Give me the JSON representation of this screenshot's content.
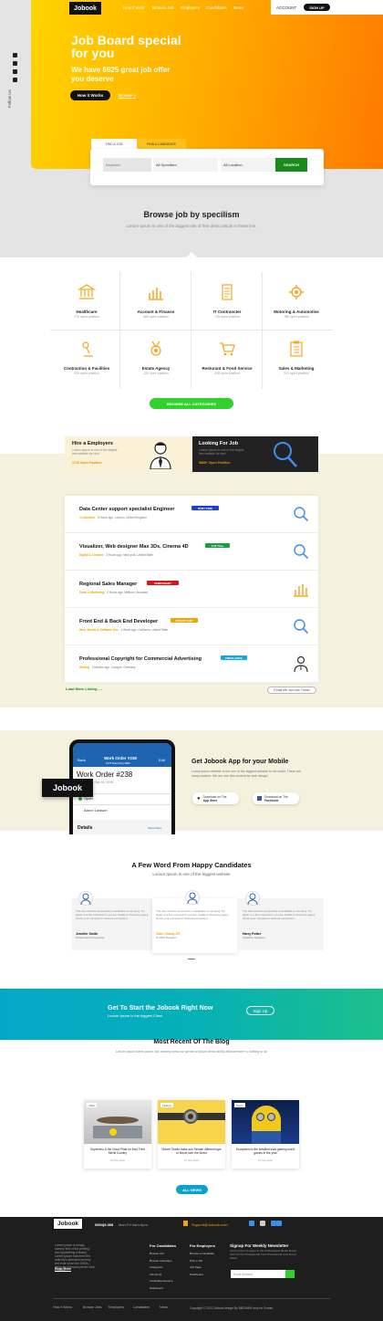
{
  "header": {
    "logo": "Jobook",
    "nav": [
      "How it work",
      "Browse Job",
      "Employers",
      "Candidates",
      "News"
    ],
    "account": "ACCOUNT",
    "signup": "SIGN UP",
    "follow": "Follow Us"
  },
  "hero": {
    "title": "Job Board special for you",
    "subtitle": "We have 6925 great job offer you deserve",
    "how_button": "How it Works",
    "browse_link": "Browse >"
  },
  "search": {
    "tab_find": "FIND A JOB",
    "tab_candidates": "FIND A CANDIDATE",
    "keyword_placeholder": "Keyword",
    "specialism": "All Specilism",
    "location": "All Location",
    "button": "SEARCH"
  },
  "browse": {
    "title": "Browse job by specilism",
    "subtitle": "Lorium Ipsum is one of the biggest site of free demo article in these line.",
    "categories": [
      {
        "name": "Healthcare",
        "count": "776 open position",
        "icon": "bank-icon"
      },
      {
        "name": "Account & Finance",
        "count": "689 open position",
        "icon": "bar-chart-icon"
      },
      {
        "name": "IT Contrancter",
        "count": "726 open position",
        "icon": "document-list-icon"
      },
      {
        "name": "Motoring & Automotive",
        "count": "786 open position",
        "icon": "gear-icon"
      },
      {
        "name": "Contraction & Facilities",
        "count": "325 open position",
        "icon": "lamp-icon"
      },
      {
        "name": "Estate Agency",
        "count": "120 open position",
        "icon": "medal-icon"
      },
      {
        "name": "Resturant & Food Service",
        "count": "508 open position",
        "icon": "cart-icon"
      },
      {
        "name": "Sales & Marketing",
        "count": "212 open position",
        "icon": "clipboard-icon"
      }
    ],
    "all_button": "BROWSE ALL CATEGORIES"
  },
  "promo": {
    "hire": {
      "title": "Hire a Employers",
      "desc": "Lorium ipsum is one of the largest free website for html",
      "positions": "1725 Open Position"
    },
    "look": {
      "title": "Looking For Job",
      "desc": "Lorium ipsum is one of the largest free website for html",
      "positions": "5685+ Open Position"
    }
  },
  "jobs": {
    "items": [
      {
        "title": "Data Center support specialist Engineer",
        "tag": "PART TIME",
        "tag_color": "#1f3fd6",
        "category": "4 Liberated",
        "time": "4 Hours ago",
        "location": "London, United Kingdom",
        "icon": "magnifier-icon"
      },
      {
        "title": "Visualizer, Web designer Max 3Ds, Cinema 4D",
        "tag": "Full Time",
        "tag_color": "#14a23c",
        "category": "Digital & Creative",
        "time": "3 Hours ago",
        "location": "New york, United State",
        "icon": "magnifier-icon"
      },
      {
        "title": "Regional Sales Manager",
        "tag": "TEMPORARY",
        "tag_color": "#d91616",
        "category": "Sales & Marketing",
        "time": "4 Hours ago",
        "location": "Melburn, Australia",
        "icon": "bar-chart-icon"
      },
      {
        "title": "Front End & Back End Developer",
        "tag": "INTERN SHIP",
        "tag_color": "#f0a500",
        "category": "Web, Mobile & Software Dev",
        "time": "1 Week ago",
        "location": "California, United State",
        "icon": "magnifier-icon"
      },
      {
        "title": "Professional Copyright for Commercial Advertising",
        "tag": "FREELANCE",
        "tag_color": "#17a8d8",
        "category": "Writing",
        "time": "2 Months ago",
        "location": "Cologne, Germany",
        "icon": "person-icon"
      }
    ],
    "load_more": "Load More Listing ....",
    "email_me": "Email Me Job Like These"
  },
  "app": {
    "phone_title": "Work Order #238",
    "phone_sub": "1275 Branching 4850",
    "phone_back": "Back",
    "phone_edit": "Edit",
    "phone_heading": "Work Order #238",
    "phone_date": "Due Sep 16, 2016",
    "phone_status": "Open",
    "phone_person": "Aaron Lawson",
    "phone_details": "Details",
    "phone_show_more": "Show More",
    "logo": "Jobook",
    "title": "Get Jobook App for your Mobile",
    "desc": "Lorius Ipsum website is the one of the biggest website to the world. There are many content. We are use this content for web design.",
    "appstore_small": "Download on The",
    "appstore": "App Store",
    "facebook_small": "Download on The",
    "facebook": "Facebook"
  },
  "testimonials": {
    "title": "A Few Word From Happy Candidates",
    "subtitle": "Lorium Ipsum is one of the biggest website",
    "items": [
      {
        "text": "The site could be temporarily unavailable or too busy. Try again in a few moments if you are unable to load any pages, check your computer's network connection.",
        "name": "Jennifer Smith",
        "role": "Professional Copywriter"
      },
      {
        "text": "The site could be temporarily unavailable or too busy. Try again in a few moments if you are unable to load any pages, check your computer's network connection.",
        "name": "John Chong JR",
        "role": "UI Web Designer"
      },
      {
        "text": "The site could be temporarily unavailable or too busy. Try again in a few moments if you are unable to load any pages, check your computer's network connection.",
        "name": "Harry Potter",
        "role": "Graphics Designer"
      }
    ]
  },
  "cta": {
    "title": "Get To Start the Jobook Right Now",
    "subtitle": "Lorium Ipsum is the biggest Client",
    "button": "Sign Up"
  },
  "blog": {
    "title": "Most Recent Of The Blog",
    "subtitle": "Lorium Ipsum lorem ipsum has dummy meta our gentre ai ipsum demo ability alliance there is nothing to do",
    "items": [
      {
        "tag": "Video",
        "title": "Superhero & the Good Pride for they Third Minifil Country",
        "date": "25 Nov 2016"
      },
      {
        "tag": "Fashion",
        "title": "Marvel Studio make and Sinister different type of Movie over the World",
        "date": "27 Nov 2016"
      },
      {
        "tag": "Game",
        "title": "Ecosystem is the smallest work gaming world games in the year",
        "date": "23 Nov 2016"
      }
    ],
    "all_button": "ALL NEWS"
  },
  "footer": {
    "logo": "Jobook",
    "phone": "0854(5.368",
    "hours": "Mon-Fri 9am-9pm",
    "email": "Support@Jobook.com",
    "about": "Lorem Ipsum is simply dummy text of the printing and typesetting industry. Lorem Ipsum has been the industry's standard dummy text ever since the 1500s, when an unknown printer took a galley.",
    "read_more": "Read More",
    "candidates_title": "For Candidates",
    "candidates": [
      "Browse Job",
      "Browse Campaign",
      "Categories",
      "Job Alerts",
      "Candidate Resume",
      "Dashboard"
    ],
    "employers_title": "For Employers",
    "employers": [
      "Browse a Candidate",
      "Post a Job",
      "Job Page",
      "Dashboard"
    ],
    "newsletter_title": "Signup For Weekly Newsletter",
    "newsletter_desc": "Lorem Ipsum is better in the Professional. Better Email Alert for the Professional Cool Professional Cool Good Week.",
    "email_placeholder": "Email Address",
    "bottom_links": [
      "How it Works",
      "Browse Jobs",
      "Employers",
      "Candidates",
      "News"
    ],
    "copyright": "Copyright © 2022 Jobook design By BBOAHIN only for Evanto"
  }
}
